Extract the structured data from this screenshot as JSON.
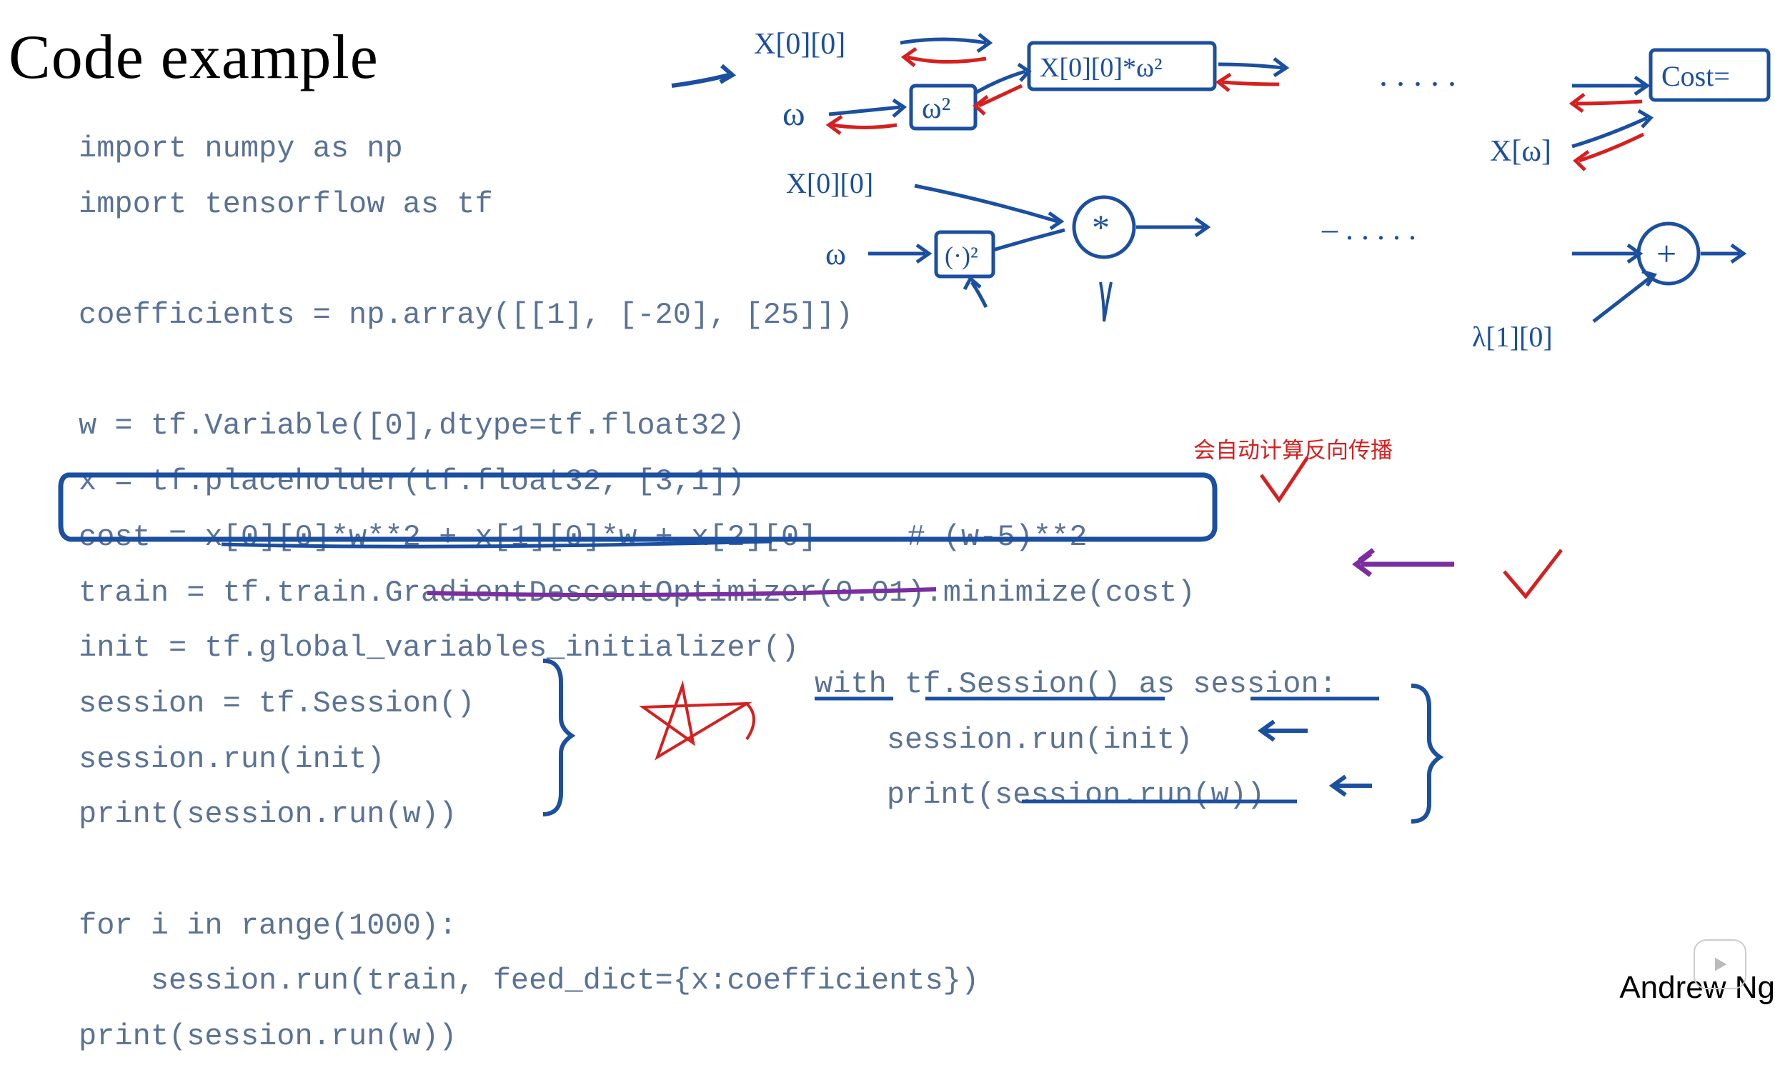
{
  "title": "Code example",
  "code": {
    "l1": "import numpy as np",
    "l2": "import tensorflow as tf",
    "l3": "",
    "l4": "coefficients = np.array([[1], [-20], [25]])",
    "l5": "",
    "l6": "w = tf.Variable([0],dtype=tf.float32)",
    "l7": "x = tf.placeholder(tf.float32, [3,1])",
    "l8": "cost = x[0][0]*w**2 + x[1][0]*w + x[2][0]     # (w-5)**2",
    "l9": "train = tf.train.GradientDescentOptimizer(0.01).minimize(cost)",
    "l10": "init = tf.global_variables_initializer()",
    "l11": "session = tf.Session()",
    "l12": "session.run(init)",
    "l13": "print(session.run(w))",
    "l14": "",
    "l15": "for i in range(1000):",
    "l16": "    session.run(train, feed_dict={x:coefficients})",
    "l17": "print(session.run(w))"
  },
  "alt_block": {
    "l1": "with tf.Session() as session:",
    "l2": "    session.run(init)",
    "l3": "    print(session.run(w))"
  },
  "annotations": {
    "red_text": "会自动计算反向传播",
    "handw": {
      "x00a": "X[0][0]",
      "w_a": "ω",
      "w2_box": "ω²",
      "xw2_box": "X[0][0]*ω²",
      "cost_box": "Cost=",
      "x00b": "X[0][0]",
      "w_b": "ω",
      "sq_box": "(·)²",
      "star": "*",
      "plus": "+",
      "lambda": "λ[1][0]",
      "dots": ". . . . .",
      "xw": "X[ω]"
    }
  },
  "credit": "Andrew Ng"
}
